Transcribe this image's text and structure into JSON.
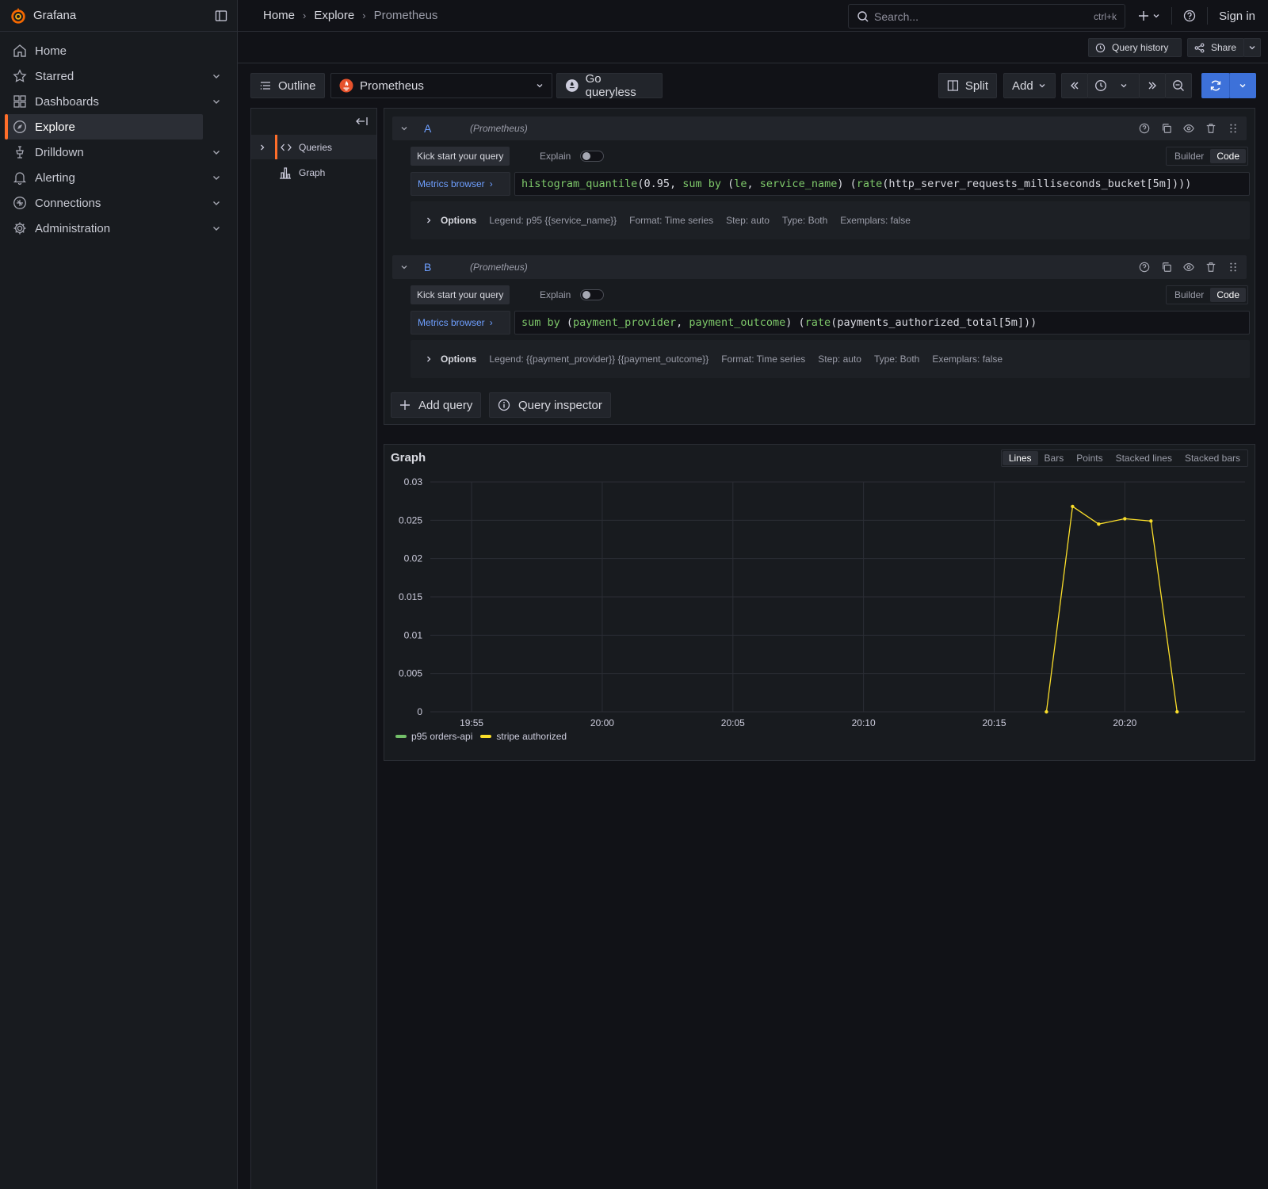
{
  "app": {
    "name": "Grafana"
  },
  "sidebar": {
    "items": [
      {
        "label": "Home",
        "icon": "home-icon",
        "active": false,
        "expandable": false
      },
      {
        "label": "Starred",
        "icon": "star-icon",
        "active": false,
        "expandable": true
      },
      {
        "label": "Dashboards",
        "icon": "apps-icon",
        "active": false,
        "expandable": true
      },
      {
        "label": "Explore",
        "icon": "compass-icon",
        "active": true,
        "expandable": false
      },
      {
        "label": "Drilldown",
        "icon": "drilldown-icon",
        "active": false,
        "expandable": true
      },
      {
        "label": "Alerting",
        "icon": "bell-icon",
        "active": false,
        "expandable": true
      },
      {
        "label": "Connections",
        "icon": "connections-icon",
        "active": false,
        "expandable": true
      },
      {
        "label": "Administration",
        "icon": "cog-icon",
        "active": false,
        "expandable": true
      }
    ]
  },
  "topbar": {
    "breadcrumbs": [
      "Home",
      "Explore",
      "Prometheus"
    ],
    "search_placeholder": "Search...",
    "search_shortcut": "ctrl+k",
    "sign_in": "Sign in"
  },
  "subbar": {
    "query_history": "Query history",
    "share": "Share"
  },
  "toolbar": {
    "outline": "Outline",
    "datasource": "Prometheus",
    "go_queryless": "Go queryless",
    "split": "Split",
    "add": "Add"
  },
  "outline_panel": {
    "items": [
      "Queries",
      "Graph"
    ]
  },
  "queries": [
    {
      "letter": "A",
      "datasource": "(Prometheus)",
      "kickstart": "Kick start your query",
      "explain": "Explain",
      "builder": "Builder",
      "code": "Code",
      "metrics_browser": "Metrics browser",
      "expr_parts": {
        "p1": "histogram_quantile",
        "p2": "(0.95, ",
        "p3": "sum by",
        "p4": " (",
        "p5": "le",
        "p6": ", ",
        "p7": "service_name",
        "p8": ") (",
        "p9": "rate",
        "p10": "(http_server_requests_milliseconds_bucket[5m])))"
      },
      "options_label": "Options",
      "options": [
        "Legend: p95 {{service_name}}",
        "Format: Time series",
        "Step: auto",
        "Type: Both",
        "Exemplars: false"
      ]
    },
    {
      "letter": "B",
      "datasource": "(Prometheus)",
      "kickstart": "Kick start your query",
      "explain": "Explain",
      "builder": "Builder",
      "code": "Code",
      "metrics_browser": "Metrics browser",
      "expr_parts": {
        "p1": "sum by",
        "p2": " (",
        "p3": "payment_provider",
        "p4": ", ",
        "p5": "payment_outcome",
        "p6": ") (",
        "p7": "rate",
        "p8": "(payments_authorized_total[5m]))"
      },
      "options_label": "Options",
      "options": [
        "Legend: {{payment_provider}} {{payment_outcome}}",
        "Format: Time series",
        "Step: auto",
        "Type: Both",
        "Exemplars: false"
      ]
    }
  ],
  "query_actions": {
    "add_query": "Add query",
    "query_inspector": "Query inspector"
  },
  "graph": {
    "title": "Graph",
    "modes": [
      "Lines",
      "Bars",
      "Points",
      "Stacked lines",
      "Stacked bars"
    ],
    "active_mode": "Lines"
  },
  "chart_data": {
    "type": "line",
    "x_ticks": [
      "19:55",
      "20:00",
      "20:05",
      "20:10",
      "20:15",
      "20:20"
    ],
    "y_ticks": [
      "0",
      "0.005",
      "0.01",
      "0.015",
      "0.02",
      "0.025",
      "0.03"
    ],
    "ylim": [
      0,
      0.03
    ],
    "grid": true,
    "legend_position": "bottom-left",
    "series": [
      {
        "name": "p95 orders-api",
        "color": "#73bf69",
        "points": []
      },
      {
        "name": "stripe authorized",
        "color": "#fade2a",
        "points": [
          [
            "20:17:00",
            0
          ],
          [
            "20:18:00",
            0.0268
          ],
          [
            "20:19:00",
            0.0245
          ],
          [
            "20:20:00",
            0.0252
          ],
          [
            "20:21:00",
            0.0249
          ],
          [
            "20:22:00",
            0
          ]
        ]
      }
    ]
  }
}
